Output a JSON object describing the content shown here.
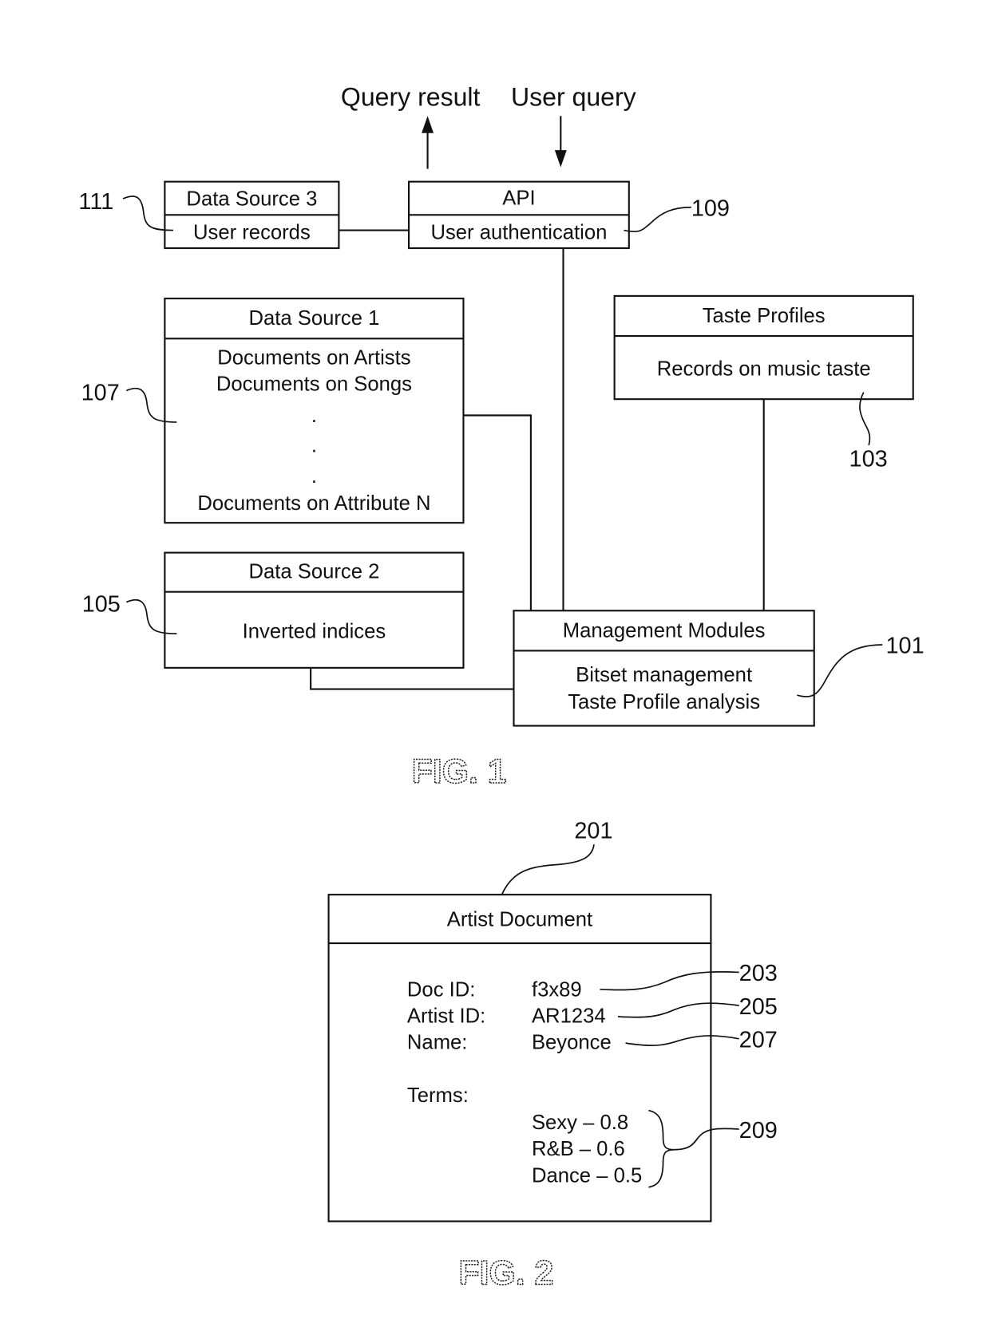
{
  "fig1": {
    "caption": "FIG. 1",
    "io": {
      "query_result": "Query result",
      "user_query": "User query"
    },
    "data_source_3": {
      "title": "Data Source 3",
      "body": "User records",
      "ref": "111"
    },
    "api": {
      "title": "API",
      "body": "User authentication",
      "ref": "109"
    },
    "data_source_1": {
      "title": "Data Source 1",
      "lines": [
        "Documents on Artists",
        "Documents on Songs",
        ".",
        ".",
        ".",
        "Documents on Attribute N"
      ],
      "ref": "107"
    },
    "taste_profiles": {
      "title": "Taste Profiles",
      "body": "Records on music taste",
      "ref": "103"
    },
    "data_source_2": {
      "title": "Data Source 2",
      "body": "Inverted indices",
      "ref": "105"
    },
    "management_modules": {
      "title": "Management Modules",
      "lines": [
        "Bitset management",
        "Taste Profile analysis"
      ],
      "ref": "101"
    }
  },
  "fig2": {
    "caption": "FIG. 2",
    "artist_document": {
      "title": "Artist Document",
      "ref": "201",
      "fields": [
        {
          "label": "Doc ID:",
          "value": "f3x89",
          "ref": "203"
        },
        {
          "label": "Artist ID:",
          "value": "AR1234",
          "ref": "205"
        },
        {
          "label": "Name:",
          "value": "Beyonce",
          "ref": "207"
        }
      ],
      "terms_label": "Terms:",
      "terms": [
        "Sexy – 0.8",
        "R&B – 0.6",
        "Dance – 0.5"
      ],
      "terms_ref": "209"
    }
  }
}
